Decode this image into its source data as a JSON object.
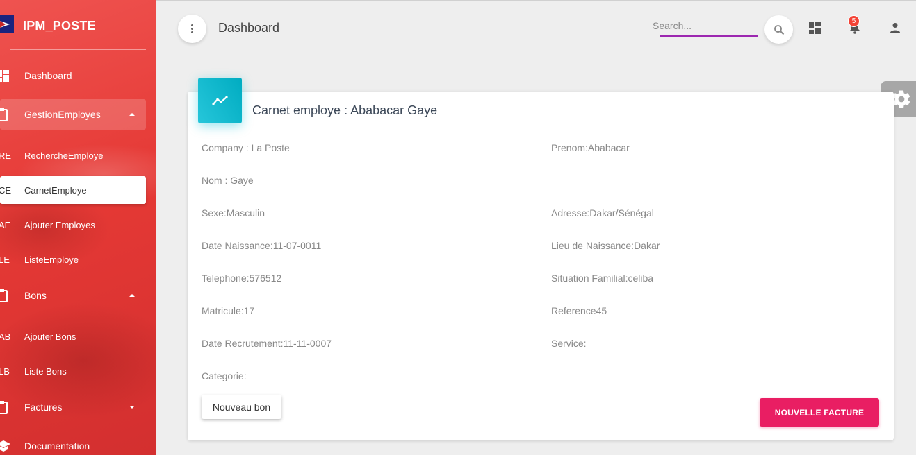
{
  "sidebar": {
    "brand": "IPM_POSTE",
    "items": [
      {
        "label": "Dashboard"
      },
      {
        "label": "GestionEmployes"
      },
      {
        "label": "Bons"
      },
      {
        "label": "Factures"
      },
      {
        "label": "Documentation"
      }
    ],
    "sub_employes": [
      {
        "abbr": "RE",
        "label": "RechercheEmploye"
      },
      {
        "abbr": "CE",
        "label": "CarnetEmploye"
      },
      {
        "abbr": "AE",
        "label": "Ajouter Employes"
      },
      {
        "abbr": "LE",
        "label": "ListeEmploye"
      }
    ],
    "sub_bons": [
      {
        "abbr": "AB",
        "label": "Ajouter Bons"
      },
      {
        "abbr": "LB",
        "label": "Liste Bons"
      }
    ]
  },
  "header": {
    "title": "Dashboard",
    "search_placeholder": "Search...",
    "notification_count": "5"
  },
  "card": {
    "title": "Carnet employe : Ababacar Gaye",
    "fields": {
      "company": "Company : La Poste",
      "prenom": "Prenom:Ababacar",
      "nom": "Nom : Gaye",
      "sexe": "Sexe:Masculin",
      "adresse": "Adresse:Dakar/Sénégal",
      "date_naissance": "Date Naissance:11-07-0011",
      "lieu_naissance": "Lieu de Naissance:Dakar",
      "telephone": "Telephone:576512",
      "situation": "Situation Familial:celiba",
      "matricule": "Matricule:17",
      "reference": "Reference45",
      "date_recrutement": "Date Recrutement:11-11-0007",
      "service": "Service:",
      "categorie": "Categorie:"
    },
    "btn_nouveau": "Nouveau bon",
    "btn_facture": "NOUVELLE FACTURE"
  },
  "colors": {
    "sidebar": "#e53935",
    "accent_purple": "#9c27b0",
    "card_icon": "#00acc1",
    "facture_btn": "#e91e63",
    "badge": "#f44336"
  }
}
